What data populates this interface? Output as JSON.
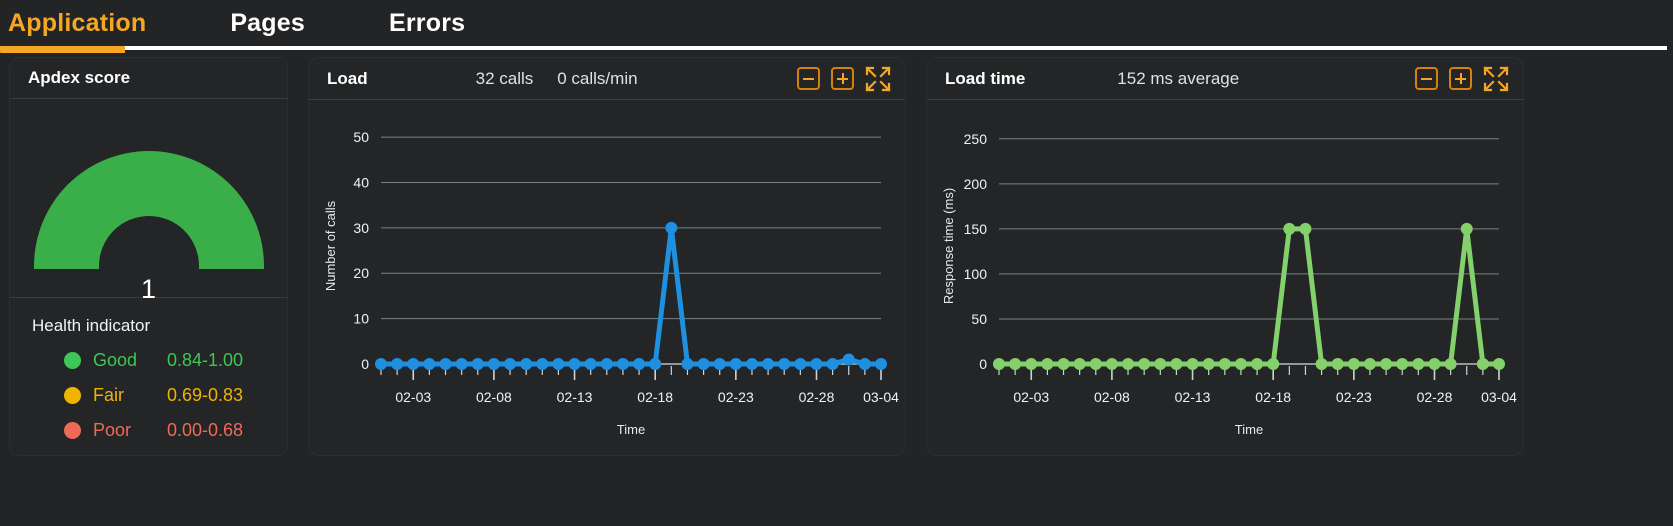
{
  "tabs": [
    {
      "label": "Application",
      "active": true
    },
    {
      "label": "Pages",
      "active": false
    },
    {
      "label": "Errors",
      "active": false
    }
  ],
  "apdex": {
    "title": "Apdex score",
    "value": "1",
    "gauge_color": "#3aae49",
    "health_title": "Health indicator",
    "levels": [
      {
        "label": "Good",
        "range": "0.84-1.00",
        "color": "#3cc756"
      },
      {
        "label": "Fair",
        "range": "0.69-0.83",
        "color": "#f0b400"
      },
      {
        "label": "Poor",
        "range": "0.00-0.68",
        "color": "#ef6a56"
      }
    ]
  },
  "load_panel": {
    "title": "Load",
    "metric_total": "32 calls",
    "metric_rate": "0 calls/min",
    "tools": [
      "minus-box-icon",
      "plus-box-icon",
      "collapse-icon"
    ]
  },
  "loadtime_panel": {
    "title": "Load time",
    "metric_avg": "152 ms average",
    "tools": [
      "minus-box-icon",
      "plus-box-icon",
      "collapse-icon"
    ]
  },
  "chart_data": [
    {
      "id": "load",
      "type": "line",
      "title": "Load",
      "xlabel": "Time",
      "ylabel": "Number of calls",
      "color": "#1f8fe0",
      "ylim": [
        0,
        52
      ],
      "yticks": [
        0,
        10,
        20,
        30,
        40,
        50
      ],
      "grid": true,
      "xticklabels": [
        "02-03",
        "02-08",
        "02-13",
        "02-18",
        "02-23",
        "02-28",
        "03-04"
      ],
      "xticklabel_indices": [
        2,
        7,
        12,
        17,
        22,
        27,
        31
      ],
      "x": [
        "02-01",
        "02-02",
        "02-03",
        "02-04",
        "02-05",
        "02-06",
        "02-07",
        "02-08",
        "02-09",
        "02-10",
        "02-11",
        "02-12",
        "02-13",
        "02-14",
        "02-15",
        "02-16",
        "02-17",
        "02-18",
        "02-19",
        "02-20",
        "02-21",
        "02-22",
        "02-23",
        "02-24",
        "02-25",
        "02-26",
        "02-27",
        "02-28",
        "03-01",
        "03-02",
        "03-03",
        "03-04"
      ],
      "values": [
        0,
        0,
        0,
        0,
        0,
        0,
        0,
        0,
        0,
        0,
        0,
        0,
        0,
        0,
        0,
        0,
        0,
        0,
        30,
        0,
        0,
        0,
        0,
        0,
        0,
        0,
        0,
        0,
        0,
        1,
        0,
        0
      ]
    },
    {
      "id": "load-time",
      "type": "line",
      "title": "Load time",
      "xlabel": "Time",
      "ylabel": "Response time (ms)",
      "color": "#84d06a",
      "ylim": [
        0,
        262
      ],
      "yticks": [
        0,
        50,
        100,
        150,
        200,
        250
      ],
      "grid": true,
      "xticklabels": [
        "02-03",
        "02-08",
        "02-13",
        "02-18",
        "02-23",
        "02-28",
        "03-04"
      ],
      "xticklabel_indices": [
        2,
        7,
        12,
        17,
        22,
        27,
        31
      ],
      "x": [
        "02-01",
        "02-02",
        "02-03",
        "02-04",
        "02-05",
        "02-06",
        "02-07",
        "02-08",
        "02-09",
        "02-10",
        "02-11",
        "02-12",
        "02-13",
        "02-14",
        "02-15",
        "02-16",
        "02-17",
        "02-18",
        "02-19",
        "02-20",
        "02-21",
        "02-22",
        "02-23",
        "02-24",
        "02-25",
        "02-26",
        "02-27",
        "02-28",
        "03-01",
        "03-02",
        "03-03",
        "03-04"
      ],
      "values": [
        0,
        0,
        0,
        0,
        0,
        0,
        0,
        0,
        0,
        0,
        0,
        0,
        0,
        0,
        0,
        0,
        0,
        0,
        150,
        150,
        0,
        0,
        0,
        0,
        0,
        0,
        0,
        0,
        0,
        150,
        0,
        0
      ]
    }
  ]
}
